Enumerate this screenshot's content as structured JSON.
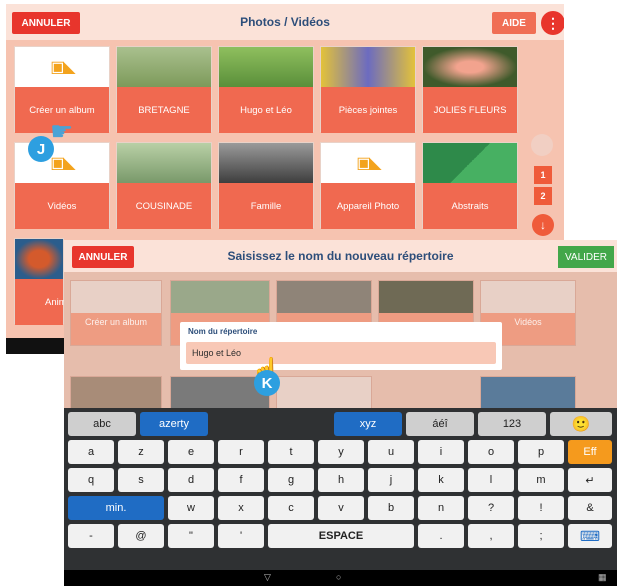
{
  "back_screen": {
    "title": "Photos / Vidéos",
    "cancel_label": "ANNULER",
    "help_label": "AIDE",
    "menu_glyph": "⋮",
    "tiles": [
      {
        "label": "Créer un album"
      },
      {
        "label": "BRETAGNE"
      },
      {
        "label": "Hugo et Léo"
      },
      {
        "label": "Pièces jointes"
      },
      {
        "label": "JOLIES FLEURS"
      },
      {
        "label": "Vidéos"
      },
      {
        "label": "COUSINADE"
      },
      {
        "label": "Famille"
      },
      {
        "label": "Appareil Photo"
      },
      {
        "label": "Abstraits"
      },
      {
        "label": "Anim"
      }
    ],
    "pages": [
      "1",
      "2"
    ],
    "marker": "J"
  },
  "front_screen": {
    "title": "Saisissez le nom du nouveau répertoire",
    "cancel_label": "ANNULER",
    "validate_label": "VALIDER",
    "bg_tiles": [
      {
        "label": "Créer un album"
      },
      {
        "label": ""
      },
      {
        "label": ""
      },
      {
        "label": ""
      },
      {
        "label": "Vidéos"
      }
    ],
    "dialog_label": "Nom du répertoire",
    "dialog_value": "Hugo et Léo",
    "marker": "K"
  },
  "keyboard": {
    "row0": [
      "abc",
      "azerty",
      "xyz",
      "áéî",
      "123",
      "🙂"
    ],
    "row1": [
      "a",
      "z",
      "e",
      "r",
      "t",
      "y",
      "u",
      "i",
      "o",
      "p",
      "Eff"
    ],
    "row2": [
      "q",
      "s",
      "d",
      "f",
      "g",
      "h",
      "j",
      "k",
      "l",
      "m",
      "↵"
    ],
    "row3": [
      "min.",
      "w",
      "x",
      "c",
      "v",
      "b",
      "n",
      "?",
      "!",
      "&"
    ],
    "row4": [
      "-",
      "@",
      "\"",
      "'",
      "ESPACE",
      ".",
      ",",
      ";",
      ":",
      "⌨"
    ]
  },
  "colors": {
    "accent_red": "#e8352c",
    "tile_orange": "#f06950",
    "keyboard_blue": "#1f6cc4",
    "validate_green": "#43a74a",
    "marker_blue": "#2d9fe0"
  }
}
